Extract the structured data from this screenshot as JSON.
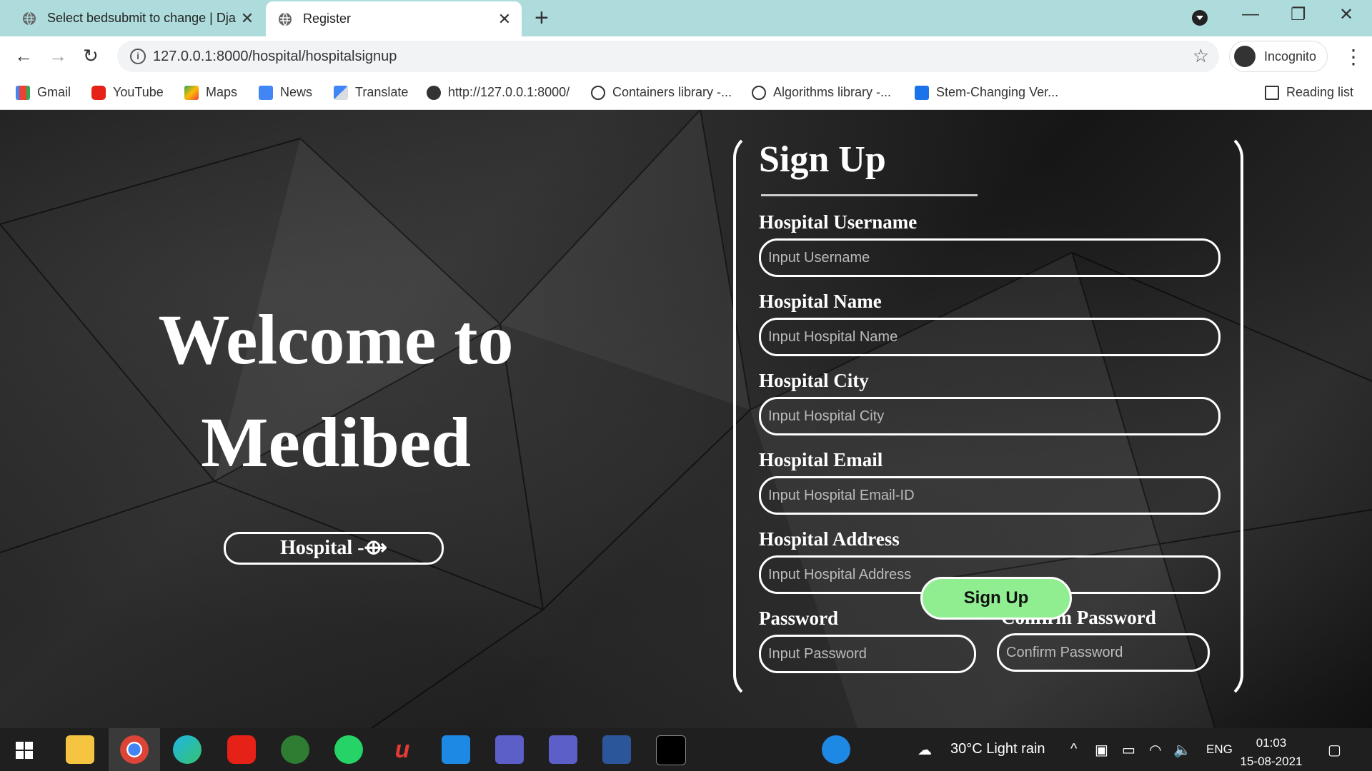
{
  "browser": {
    "tabs": [
      {
        "title": "Select bedsubmit to change | Dja",
        "active": false
      },
      {
        "title": "Register",
        "active": true
      }
    ],
    "url": "127.0.0.1:8000/hospital/hospitalsignup",
    "profile": "Incognito",
    "bookmarks": [
      "Gmail",
      "YouTube",
      "Maps",
      "News",
      "Translate",
      "http://127.0.0.1:8000/",
      "Containers library -...",
      "Algorithms library -...",
      "Stem-Changing Ver...",
      "Reading list"
    ]
  },
  "welcome": {
    "line1": "Welcome to",
    "line2": "Medibed",
    "button": "Hospital -⟴"
  },
  "form": {
    "title": "Sign Up",
    "username": {
      "label": "Hospital Username",
      "placeholder": "Input Username"
    },
    "name": {
      "label": "Hospital Name",
      "placeholder": "Input Hospital Name"
    },
    "city": {
      "label": "Hospital City",
      "placeholder": "Input Hospital City"
    },
    "email": {
      "label": "Hospital Email",
      "placeholder": "Input Hospital Email-ID"
    },
    "address": {
      "label": "Hospital Address",
      "placeholder": "Input Hospital Address"
    },
    "password": {
      "label": "Password",
      "placeholder": "Input Password"
    },
    "confirm": {
      "label": "Confirm Password",
      "placeholder": "Confirm Password"
    },
    "submit": "Sign Up",
    "submit_color": "#90ee90"
  },
  "taskbar": {
    "weather": "30°C  Light rain",
    "lang": "ENG",
    "time": "01:03",
    "date": "15-08-2021"
  }
}
